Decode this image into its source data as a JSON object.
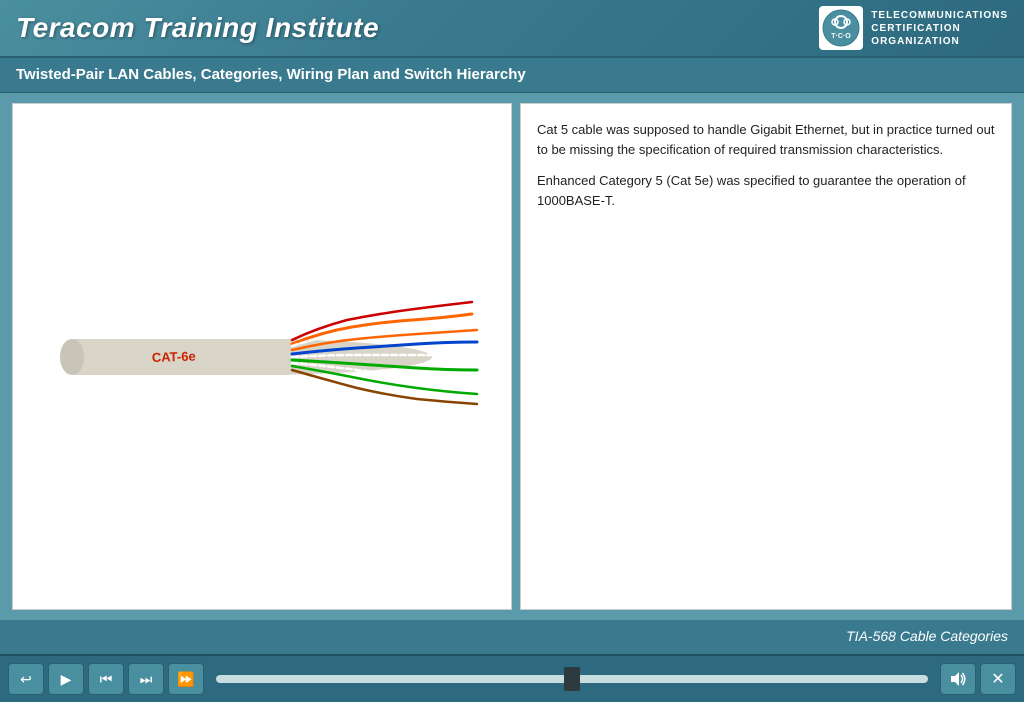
{
  "header": {
    "title": "Teracom Training Institute",
    "logo": {
      "line1": "TELECOMMUNICATIONS",
      "line2": "CERTIFICATION",
      "line3": "ORGANIZATION",
      "abbr": "T·C·O"
    }
  },
  "sub_header": {
    "title": "Twisted-Pair LAN Cables, Categories, Wiring Plan and Switch Hierarchy"
  },
  "main": {
    "text_paragraph1": "Cat 5 cable was supposed to handle Gigabit Ethernet, but in practice turned out to be missing the specification of required transmission characteristics.",
    "text_paragraph2": "Enhanced Category 5 (Cat 5e) was specified to guarantee the operation of 1000BASE-T."
  },
  "caption": {
    "text": "TIA-568 Cable Categories"
  },
  "controls": {
    "back_label": "↩",
    "play_label": "▶",
    "skip_back_label": "⏮",
    "skip_next_label": "⏭",
    "fast_forward_label": "⏩",
    "volume_label": "🔊",
    "close_label": "✕"
  }
}
